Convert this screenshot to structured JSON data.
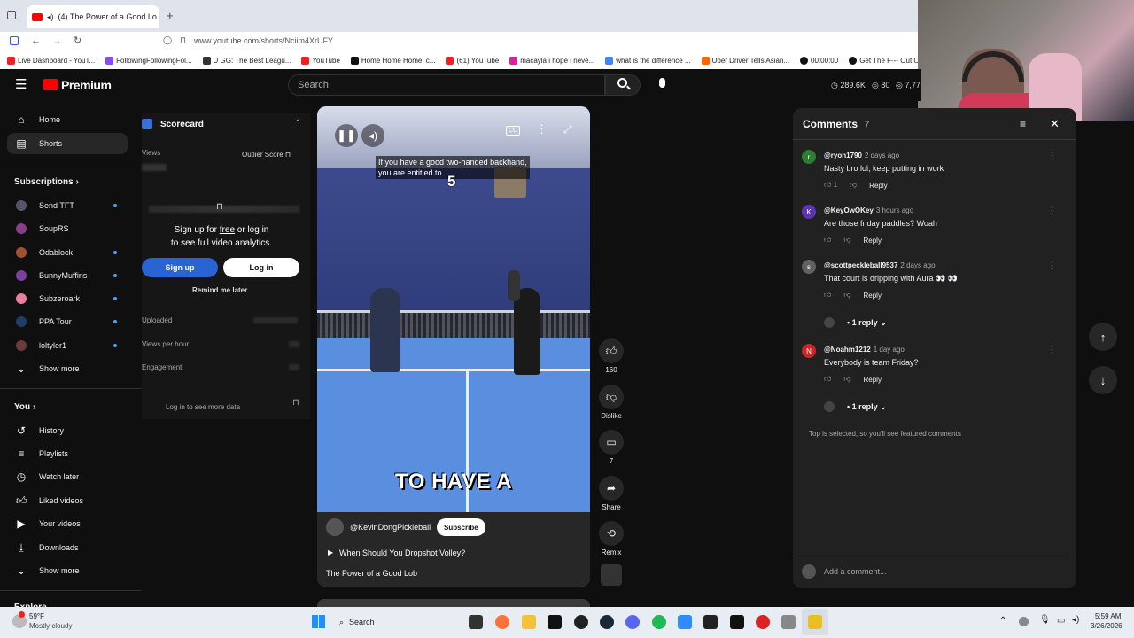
{
  "browser": {
    "tab_title": "(4) The Power of a Good Lo",
    "url": "www.youtube.com/shorts/Nciim4XrUFY",
    "bookmarks": [
      "Live Dashboard - YouT...",
      "FollowingFollowingFol...",
      "U GG: The Best Leagu...",
      "YouTube",
      "Home Home Home, c...",
      "(61) YouTube",
      "macayla i hope i neve...",
      "what is the difference ...",
      "Uber Driver Tells Asian...",
      "00:00:00",
      "Get The F--- Out Of M"
    ]
  },
  "header": {
    "logo": "Premium",
    "search_placeholder": "Search",
    "stats": {
      "views": "289.6K",
      "count": "80",
      "extra": "7,77"
    }
  },
  "sidebar": {
    "nav": [
      {
        "label": "Home"
      },
      {
        "label": "Shorts"
      }
    ],
    "subscriptions_title": "Subscriptions",
    "subscriptions": [
      {
        "label": "Send TFT",
        "color": "#556"
      },
      {
        "label": "SoupRS",
        "color": "#8a3d8a"
      },
      {
        "label": "Odablock",
        "color": "#a0522d"
      },
      {
        "label": "BunnyMuffins",
        "color": "#7b3f9e"
      },
      {
        "label": "Subzeroark",
        "color": "#e87fa0"
      },
      {
        "label": "PPA Tour",
        "color": "#1e3d6b"
      },
      {
        "label": "loltyler1",
        "color": "#6b3a3a"
      }
    ],
    "show_more": "Show more",
    "you_title": "You",
    "you_items": [
      {
        "label": "History"
      },
      {
        "label": "Playlists"
      },
      {
        "label": "Watch later"
      },
      {
        "label": "Liked videos"
      },
      {
        "label": "Your videos"
      },
      {
        "label": "Downloads"
      }
    ],
    "show_more2": "Show more",
    "explore": "Explore"
  },
  "scorecard": {
    "title": "Scorecard",
    "views_label": "Views",
    "outlier_label": "Outlier Score",
    "signup_text_1": "Sign up for ",
    "signup_free": "free",
    "signup_text_2": " or log in",
    "signup_text_3": "to see full video analytics.",
    "signup_button": "Sign up",
    "login_button": "Log in",
    "remind": "Remind me later",
    "uploaded": "Uploaded",
    "views_per_hour": "Views per hour",
    "engagement": "Engagement",
    "login_more": "Log in to see more data"
  },
  "video": {
    "caption_top": "If you have a good two-handed backhand,",
    "caption_top2": "you are entitled to",
    "overlay_number": "5",
    "caption_big": "TO HAVE A",
    "channel": "@KevinDongPickleball",
    "subscribe": "Subscribe",
    "playlist": "When Should You Dropshot Volley?",
    "title": "The Power of a Good Lob",
    "cc": "CC"
  },
  "actions": {
    "likes": "160",
    "dislike": "Dislike",
    "comments": "7",
    "share": "Share",
    "remix": "Remix"
  },
  "comments": {
    "title": "Comments",
    "count": "7",
    "items": [
      {
        "avatar": "r",
        "color": "#2e7d32",
        "handle": "@ryon1790",
        "time": "2 days ago",
        "text": "Nasty bro lol, keep putting in work",
        "likes": "1",
        "reply": "Reply"
      },
      {
        "avatar": "K",
        "color": "#5e35b1",
        "handle": "@KeyOwOKey",
        "time": "3 hours ago",
        "text": "Are those friday paddles? Woah",
        "likes": "",
        "reply": "Reply"
      },
      {
        "avatar": "s",
        "color": "#616161",
        "handle": "@scottpeckleball9537",
        "time": "2 days ago",
        "text": "That court is dripping with Aura 👀 👀",
        "likes": "",
        "reply": "Reply",
        "replies": "1 reply"
      },
      {
        "avatar": "N",
        "color": "#c62828",
        "handle": "@Noahm1212",
        "time": "1 day ago",
        "text": "Everybody is team Friday?",
        "likes": "",
        "reply": "Reply",
        "replies": "1 reply"
      }
    ],
    "footer_note": "Top is selected, so you'll see featured comments",
    "add_placeholder": "Add a comment..."
  },
  "taskbar": {
    "temp": "59°F",
    "weather": "Mostly cloudy",
    "search": "Search",
    "time": "5:59 AM",
    "date": "3/26/2026"
  }
}
